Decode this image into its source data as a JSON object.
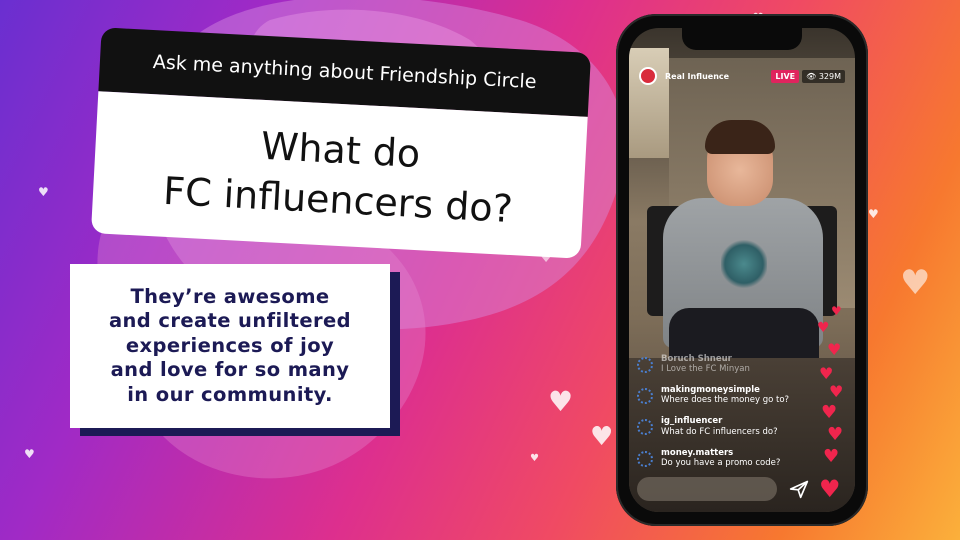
{
  "question": {
    "header": "Ask me anything about Friendship Circle",
    "text": "What do\nFC influencers do?"
  },
  "answer": {
    "text": "They’re awesome\nand create unfiltered\nexperiences of joy\nand love for so many\nin our community."
  },
  "stream": {
    "host_name": "Real Influence",
    "live_label": "LIVE",
    "viewer_count": "329M",
    "comments": [
      {
        "user": "Boruch Shneur",
        "text": "I Love the FC Minyan"
      },
      {
        "user": "makingmoneysimple",
        "text": "Where does the money go to?"
      },
      {
        "user": "ig_influencer",
        "text": "What do FC influencers do?"
      },
      {
        "user": "money.matters",
        "text": "Do you have a promo code?"
      }
    ],
    "icons": {
      "send": "send-icon",
      "like": "heart-icon",
      "viewers": "eye-icon",
      "host": "profile-avatar"
    }
  },
  "colors": {
    "navy": "#1c1a55",
    "live": "#e0245e",
    "heart": "#f0254d",
    "gradient_start": "#6a2fd0",
    "gradient_end": "#fbb03b"
  }
}
